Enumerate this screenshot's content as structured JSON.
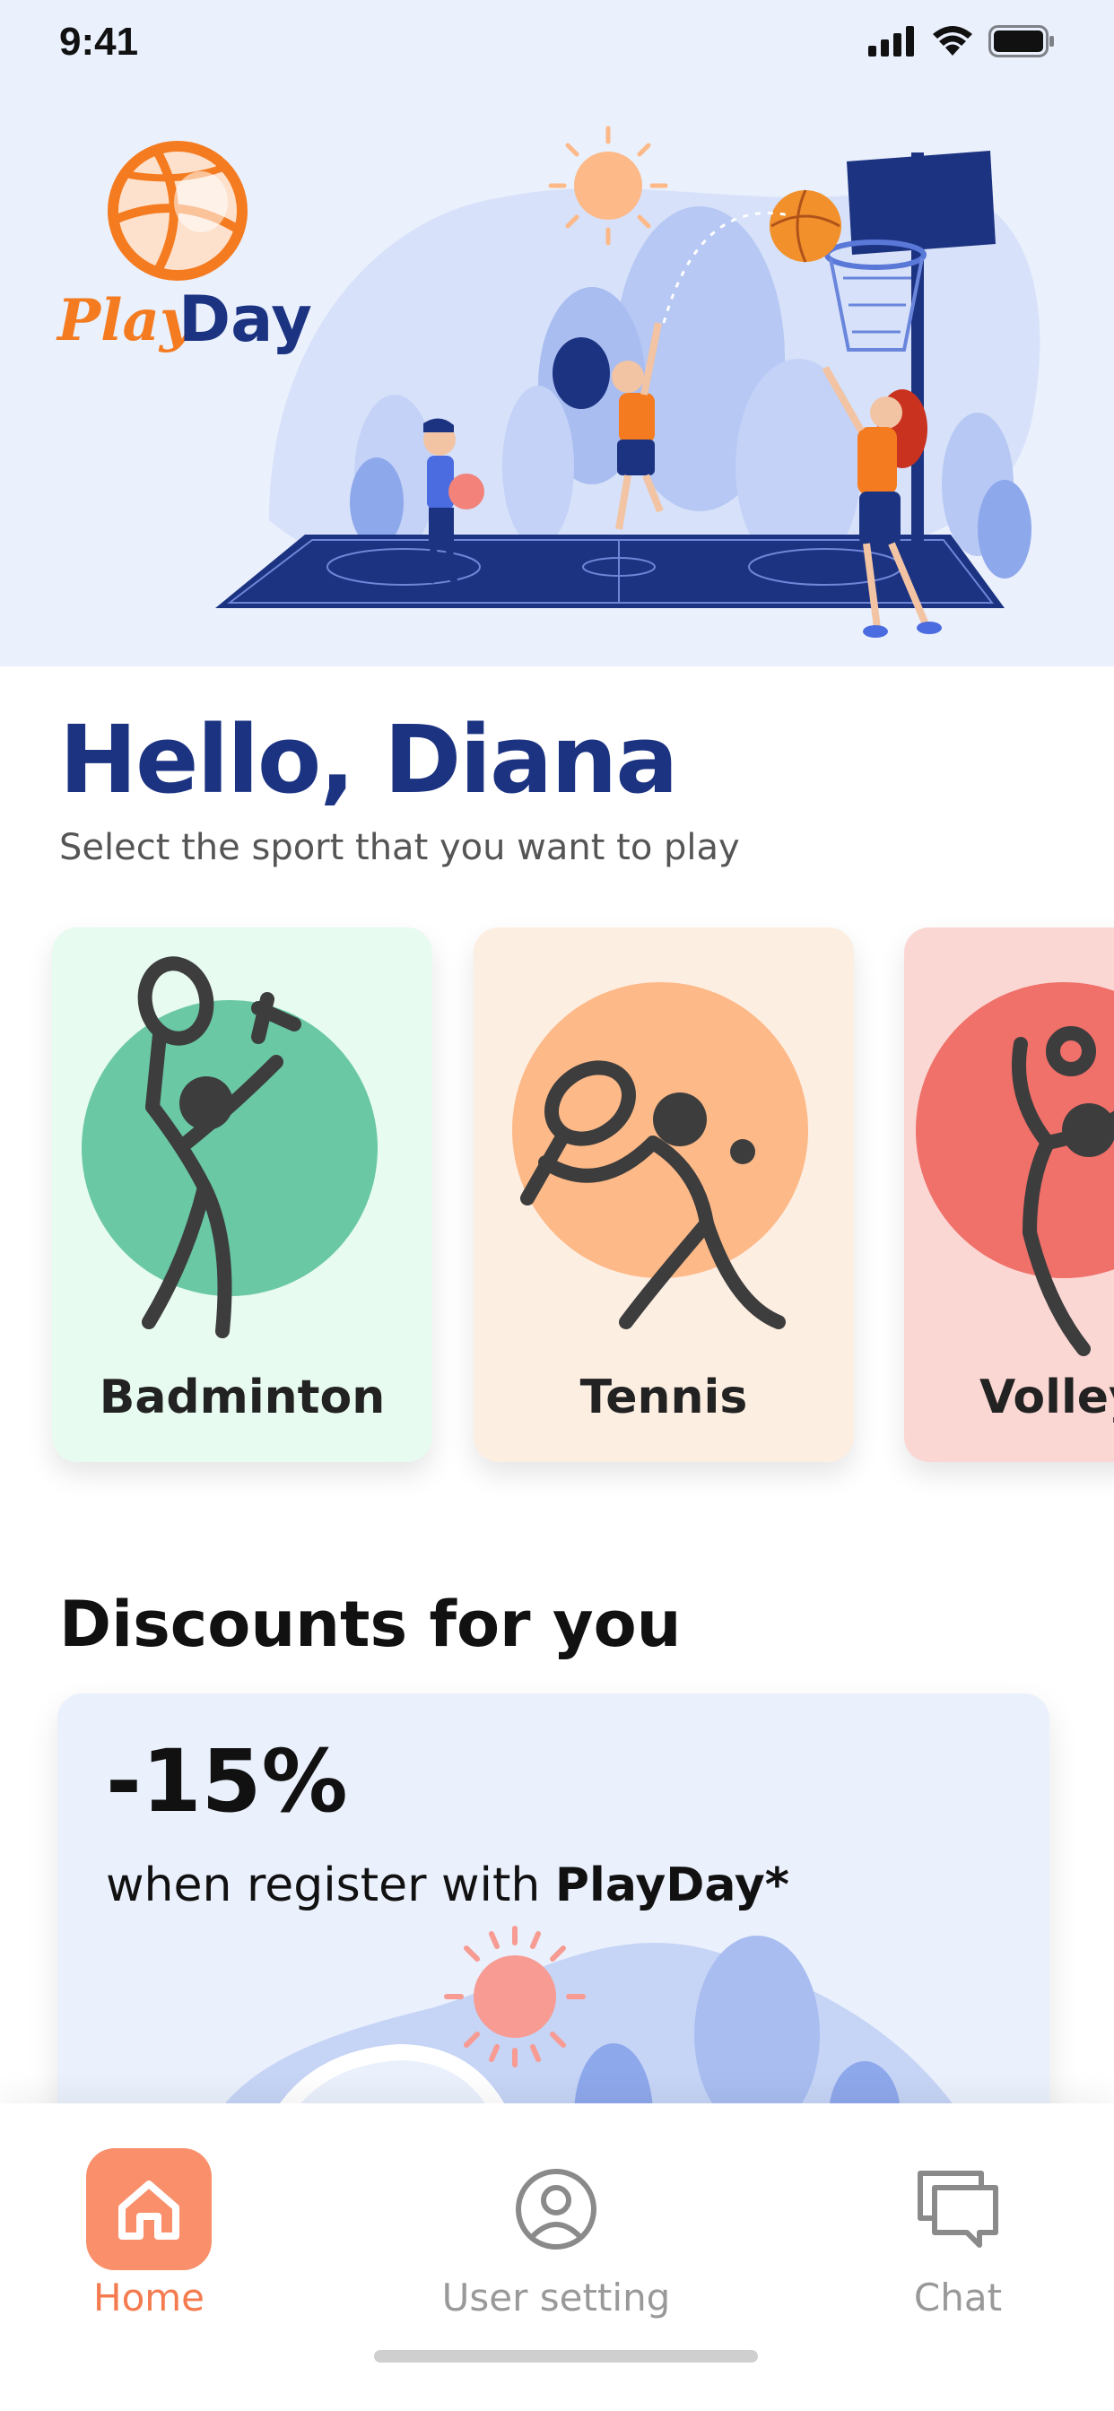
{
  "status_bar": {
    "time": "9:41"
  },
  "brand": {
    "play": "Play",
    "day": "Day"
  },
  "greeting": {
    "title": "Hello, Diana",
    "subtitle": "Select the sport that you want to play"
  },
  "sports": [
    {
      "label": "Badminton",
      "bg": "#e8fbf1",
      "accent": "#6ac8a5"
    },
    {
      "label": "Tennis",
      "bg": "#fdeee2",
      "accent": "#fdb988"
    },
    {
      "label": "Volley",
      "bg": "#fbd7d3",
      "accent": "#f0706a"
    }
  ],
  "discounts": {
    "title": "Discounts for you",
    "value": "-15%",
    "text_prefix": "when register with ",
    "text_brand": "PlayDay*"
  },
  "tabs": [
    {
      "label": "Home",
      "icon": "home-icon",
      "active": true
    },
    {
      "label": "User setting",
      "icon": "user-icon",
      "active": false
    },
    {
      "label": "Chat",
      "icon": "chat-icon",
      "active": false
    }
  ],
  "colors": {
    "brand_orange": "#f47b20",
    "brand_navy": "#1c3382",
    "tab_active": "#f9906b"
  }
}
